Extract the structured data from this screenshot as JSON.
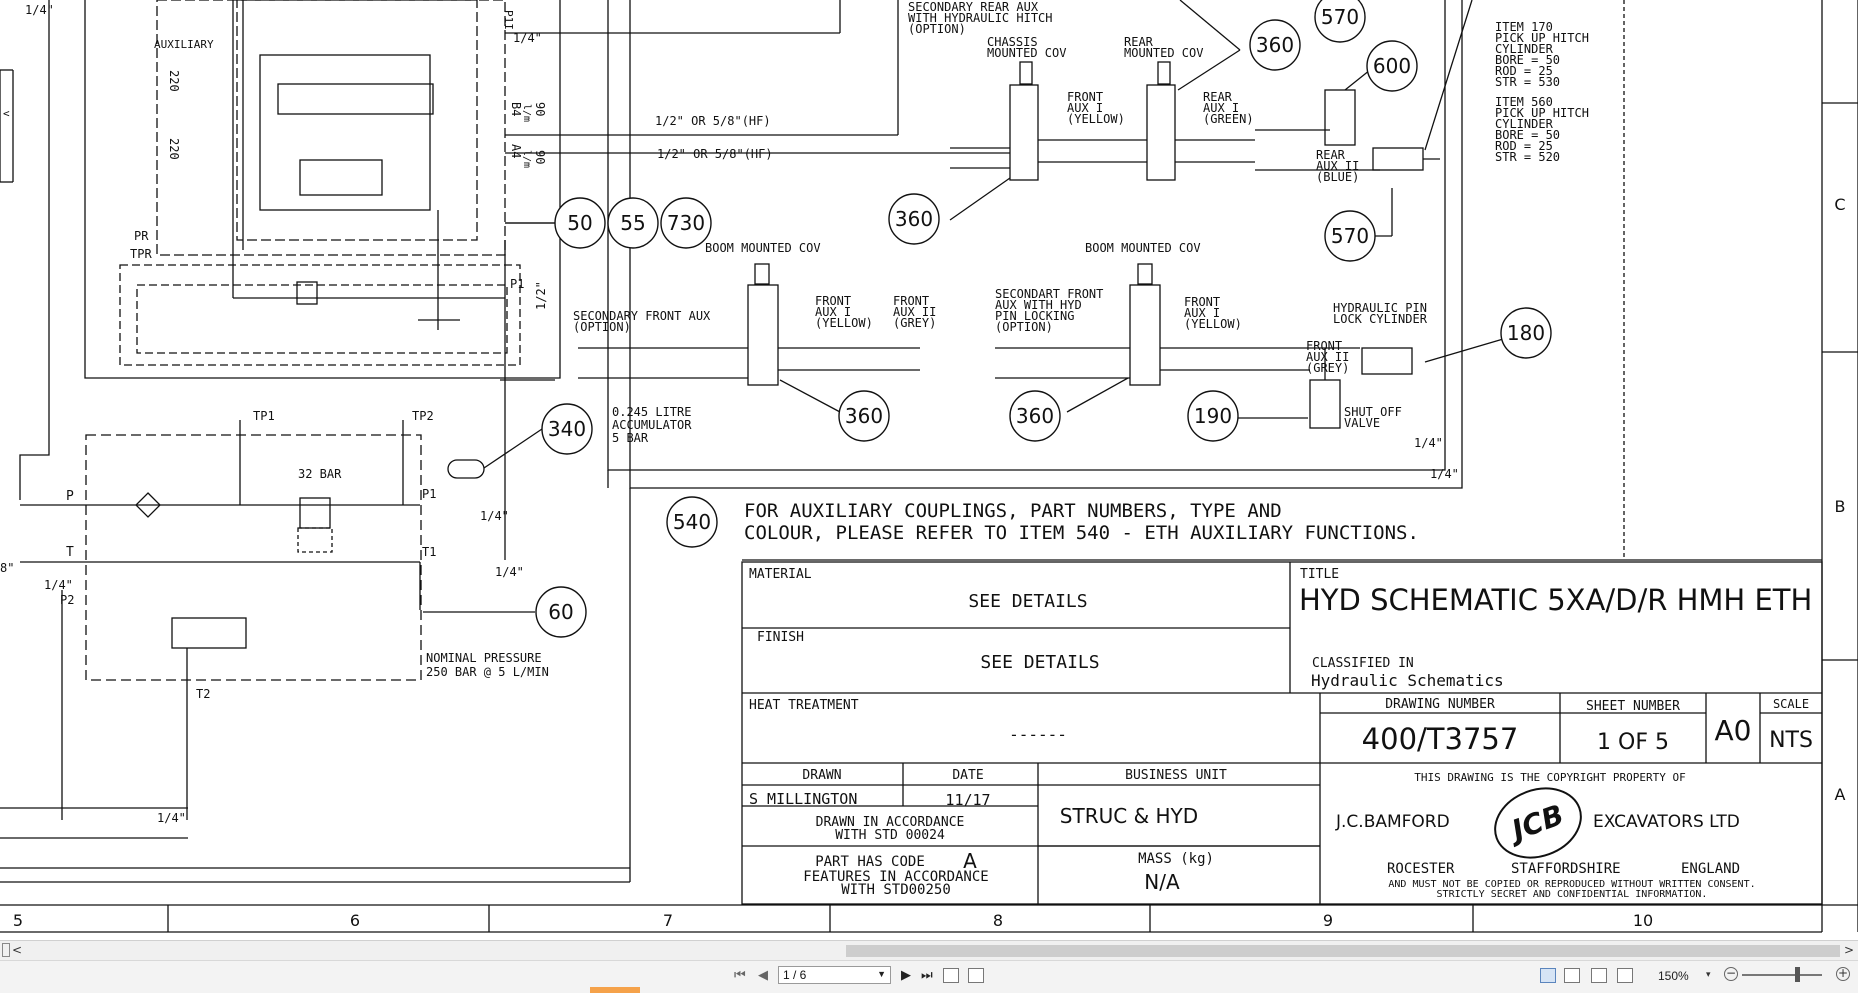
{
  "drawing": {
    "upper_left": {
      "auxiliary": "AUXILIARY",
      "fitting_quarter": "1/4\"",
      "valve_220_a": "220",
      "valve_220_b": "220",
      "port_b4": "B4",
      "port_a4": "A4",
      "flow_90_a": "90",
      "flow_90_b": "90",
      "unit_lmin": "l/m",
      "pipe_size_1": "1/2\" OR 5/8\"(HF)",
      "pipe_size_2": "1/2\" OR 5/8\"(HF)",
      "pr": "PR",
      "tpr": "TPR",
      "p1": "P1",
      "p11": "P1I",
      "half": "1/2\"",
      "fitting_8": "8\"",
      "fitting_14a": "1/4\"",
      "p2": "P2"
    },
    "filter_group": {
      "tp1": "TP1",
      "tp2": "TP2",
      "bar32": "32 BAR",
      "p": "P",
      "t": "T",
      "p1": "P1",
      "t1": "T1",
      "t2": "T2",
      "q1": "1/4\"",
      "q2": "1/4\"",
      "q3": "1/4\"",
      "nominal_1": "NOMINAL PRESSURE",
      "nominal_2": "250 BAR @ 5 L/MIN",
      "acc_1": "0.245 LITRE",
      "acc_2": "ACCUMULATOR",
      "acc_3": "5 BAR"
    },
    "callouts": {
      "c50": "50",
      "c55": "55",
      "c730": "730",
      "c340": "340",
      "c60": "60",
      "c360a": "360",
      "c360b": "360",
      "c360c": "360",
      "c360d": "360",
      "c570a": "570",
      "c570b": "570",
      "c600": "600",
      "c180": "180",
      "c190": "190",
      "c540": "540"
    },
    "rear_section": {
      "secondary_rear_1": "SECONDARY REAR AUX",
      "secondary_rear_2": "WITH HYDRAULIC HITCH",
      "secondary_rear_3": "(OPTION)",
      "chassis_1": "CHASSIS",
      "chassis_2": "MOUNTED COV",
      "rear_1": "REAR",
      "rear_2": "MOUNTED COV",
      "front_aux_1": "FRONT",
      "front_aux_2": "AUX I",
      "front_aux_3": "(YELLOW)",
      "rear_aux_1": "REAR",
      "rear_aux_2": "AUX I",
      "rear_aux_3": "(GREEN)",
      "rear_aux2_1": "REAR",
      "rear_aux2_2": "AUX II",
      "rear_aux2_3": "(BLUE)",
      "item170_1": "ITEM 170",
      "item170_2": "PICK UP HITCH",
      "item170_3": "CYLINDER",
      "item170_4": "BORE  =  50",
      "item170_5": "ROD   =  25",
      "item170_6": "STR   = 530",
      "item560_1": "ITEM 560",
      "item560_2": "PICK UP HITCH",
      "item560_3": "CYLINDER",
      "item560_4": "BORE  =  50",
      "item560_5": "ROD   =  25",
      "item560_6": "STR   = 520"
    },
    "front_section": {
      "boom_1": "BOOM MOUNTED COV",
      "boom_2": "BOOM MOUNTED COV",
      "sec_front_1": "SECONDARY FRONT AUX",
      "sec_front_2": "(OPTION)",
      "front_aux1_1": "FRONT",
      "front_aux1_2": "AUX I",
      "front_aux1_3": "(YELLOW)",
      "front_aux2_1": "FRONT",
      "front_aux2_2": "AUX II",
      "front_aux2_3": "(GREY)",
      "secondart_1": "SECONDART FRONT",
      "secondart_2": "AUX WITH HYD",
      "secondart_3": "PIN LOCKING",
      "secondart_4": "(OPTION)",
      "front_aux1b_1": "FRONT",
      "front_aux1b_2": "AUX I",
      "front_aux1b_3": "(YELLOW)",
      "front_aux2b_1": "FRONT",
      "front_aux2b_2": "AUX II",
      "front_aux2b_3": "(GREY)",
      "pin_lock_1": "HYDRAULIC PIN",
      "pin_lock_2": "LOCK CYLINDER",
      "shutoff_1": "SHUT OFF",
      "shutoff_2": "VALVE",
      "q_a": "1/4\"",
      "q_b": "1/4\""
    },
    "note": {
      "line1": "FOR AUXILIARY COUPLINGS, PART NUMBERS, TYPE AND",
      "line2": "COLOUR, PLEASE REFER TO ITEM 540 - ETH AUXILIARY FUNCTIONS."
    },
    "title_block": {
      "material_label": "MATERIAL",
      "material_value": "SEE DETAILS",
      "finish_label": "FINISH",
      "finish_value": "SEE DETAILS",
      "title_label": "TITLE",
      "title_value": "HYD SCHEMATIC 5XA/D/R HMH ETH",
      "classified_label": "CLASSIFIED IN",
      "classified_value": "Hydraulic Schematics",
      "heat_label": "HEAT TREATMENT",
      "heat_value": "------",
      "drawing_number_label": "DRAWING NUMBER",
      "drawing_number_value": "400/T3757",
      "sheet_number_label": "SHEET NUMBER",
      "sheet_number_value": "1 OF 5",
      "size_value": "A0",
      "scale_label": "SCALE",
      "scale_value": "NTS",
      "drawn_label": "DRAWN",
      "date_label": "DATE",
      "business_unit_label": "BUSINESS UNIT",
      "drawn_value": "S MILLINGTON",
      "date_value": "11/17",
      "business_unit_value": "STRUC & HYD",
      "accordance_1": "DRAWN IN ACCORDANCE",
      "accordance_2": "WITH STD 00024",
      "partcode_1": "PART HAS CODE",
      "partcode_letter": "A",
      "partcode_2": "FEATURES IN ACCORDANCE",
      "partcode_3": "WITH STD00250",
      "mass_label": "MASS (kg)",
      "mass_value": "N/A",
      "copyright_1": "THIS DRAWING IS THE COPYRIGHT PROPERTY OF",
      "company_left": "J.C.BAMFORD",
      "company_right": "EXCAVATORS LTD",
      "logo": "JCB",
      "loc_1": "ROCESTER",
      "loc_2": "STAFFORDSHIRE",
      "loc_3": "ENGLAND",
      "copyright_2": "AND MUST NOT BE COPIED OR REPRODUCED WITHOUT WRITTEN CONSENT.",
      "copyright_3": "STRICTLY SECRET AND CONFIDENTIAL INFORMATION."
    },
    "zones_bottom": [
      "5",
      "6",
      "7",
      "8",
      "9",
      "10"
    ],
    "zones_right": [
      "C",
      "B",
      "A"
    ],
    "left_ruler_mark": "<"
  },
  "viewer": {
    "hscroll_left": "<",
    "hscroll_right": ">",
    "first_page_icon": "first-page-icon",
    "prev_page_icon": "prev-page-icon",
    "page_field": "1 / 6",
    "next_page_icon": "next-page-icon",
    "last_page_icon": "last-page-icon",
    "zoom_value": "150%",
    "zoom_out": "−",
    "zoom_in": "+",
    "accent": "#f5a24a"
  }
}
